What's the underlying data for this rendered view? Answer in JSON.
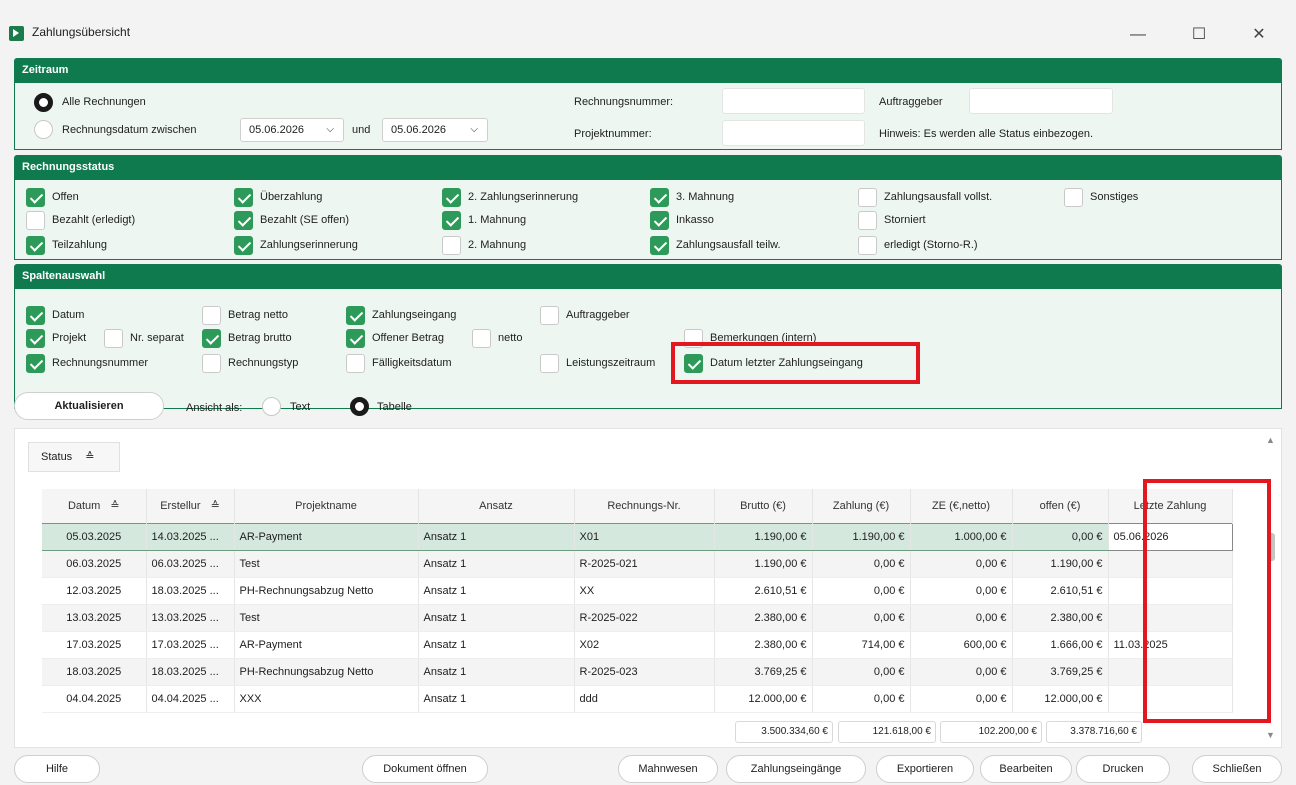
{
  "window": {
    "title": "Zahlungsübersicht",
    "min": "—",
    "max": "☐",
    "close": "✕"
  },
  "zeitraum": {
    "header": "Zeitraum",
    "alle": "Alle Rechnungen",
    "zwischen": "Rechnungsdatum zwischen",
    "date_from": "05.06.2026",
    "und": "und",
    "date_to": "05.06.2026",
    "rechnungsnummer_label": "Rechnungsnummer:",
    "projektnummer_label": "Projektnummer:",
    "auftraggeber_label": "Auftraggeber",
    "hinweis": "Hinweis: Es werden alle Status einbezogen."
  },
  "status": {
    "header": "Rechnungsstatus",
    "items": [
      {
        "label": "Offen",
        "checked": true
      },
      {
        "label": "Bezahlt (erledigt)",
        "checked": false
      },
      {
        "label": "Teilzahlung",
        "checked": true
      },
      {
        "label": "Überzahlung",
        "checked": true
      },
      {
        "label": "Bezahlt (SE offen)",
        "checked": true
      },
      {
        "label": "Zahlungserinnerung",
        "checked": true
      },
      {
        "label": "2. Zahlungserinnerung",
        "checked": true
      },
      {
        "label": "1. Mahnung",
        "checked": true
      },
      {
        "label": "2. Mahnung",
        "checked": false
      },
      {
        "label": "3. Mahnung",
        "checked": true
      },
      {
        "label": "Inkasso",
        "checked": true
      },
      {
        "label": "Zahlungsausfall teilw.",
        "checked": true
      },
      {
        "label": "Zahlungsausfall vollst.",
        "checked": false
      },
      {
        "label": "Storniert",
        "checked": false
      },
      {
        "label": "erledigt (Storno-R.)",
        "checked": false
      },
      {
        "label": "Sonstiges",
        "checked": false
      }
    ]
  },
  "spalten": {
    "header": "Spaltenauswahl",
    "items": [
      {
        "label": "Datum",
        "checked": true
      },
      {
        "label": "Projekt",
        "checked": true
      },
      {
        "label": "Nr. separat",
        "checked": false
      },
      {
        "label": "Rechnungsnummer",
        "checked": true
      },
      {
        "label": "Betrag netto",
        "checked": false
      },
      {
        "label": "Betrag brutto",
        "checked": true
      },
      {
        "label": "Rechnungstyp",
        "checked": false
      },
      {
        "label": "Zahlungseingang",
        "checked": true
      },
      {
        "label": "Offener Betrag",
        "checked": true
      },
      {
        "label": "netto",
        "checked": false
      },
      {
        "label": "Fälligkeitsdatum",
        "checked": false
      },
      {
        "label": "Auftraggeber",
        "checked": false
      },
      {
        "label": "Leistungszeitraum",
        "checked": false
      },
      {
        "label": "Bemerkungen (intern)",
        "checked": false
      },
      {
        "label": "Datum letzter Zahlungseingang",
        "checked": true
      }
    ]
  },
  "view": {
    "refresh": "Aktualisieren",
    "ansicht": "Ansicht als:",
    "text": "Text",
    "tabelle": "Tabelle",
    "group_chip": "Status",
    "sort_icon": "≙"
  },
  "table": {
    "columns": [
      "Datum",
      "Erstellur",
      "Projektname",
      "Ansatz",
      "Rechnungs-Nr.",
      "Brutto (€)",
      "Zahlung (€)",
      "ZE (€,netto)",
      "offen (€)",
      "Letzte Zahlung"
    ],
    "rows": [
      [
        "05.03.2025",
        "14.03.2025 ...",
        "AR-Payment",
        "Ansatz 1",
        "X01",
        "1.190,00 €",
        "1.190,00 €",
        "1.000,00 €",
        "0,00 €",
        "05.06.2026"
      ],
      [
        "06.03.2025",
        "06.03.2025 ...",
        "Test",
        "Ansatz 1",
        "R-2025-021",
        "1.190,00 €",
        "0,00 €",
        "0,00 €",
        "1.190,00 €",
        ""
      ],
      [
        "12.03.2025",
        "18.03.2025 ...",
        "PH-Rechnungsabzug Netto",
        "Ansatz 1",
        "XX",
        "2.610,51 €",
        "0,00 €",
        "0,00 €",
        "2.610,51 €",
        ""
      ],
      [
        "13.03.2025",
        "13.03.2025 ...",
        "Test",
        "Ansatz 1",
        "R-2025-022",
        "2.380,00 €",
        "0,00 €",
        "0,00 €",
        "2.380,00 €",
        ""
      ],
      [
        "17.03.2025",
        "17.03.2025 ...",
        "AR-Payment",
        "Ansatz 1",
        "X02",
        "2.380,00 €",
        "714,00 €",
        "600,00 €",
        "1.666,00 €",
        "11.03.2025"
      ],
      [
        "18.03.2025",
        "18.03.2025 ...",
        "PH-Rechnungsabzug Netto",
        "Ansatz 1",
        "R-2025-023",
        "3.769,25 €",
        "0,00 €",
        "0,00 €",
        "3.769,25 €",
        ""
      ],
      [
        "04.04.2025",
        "04.04.2025 ...",
        "XXX",
        "Ansatz 1",
        "ddd",
        "12.000,00 €",
        "0,00 €",
        "0,00 €",
        "12.000,00 €",
        ""
      ]
    ],
    "sums": [
      "3.500.334,60 €",
      "121.618,00 €",
      "102.200,00 €",
      "3.378.716,60 €"
    ]
  },
  "footer": {
    "hilfe": "Hilfe",
    "dokument": "Dokument öffnen",
    "mahnwesen": "Mahnwesen",
    "zahlungseingaenge": "Zahlungseingänge",
    "exportieren": "Exportieren",
    "bearbeiten": "Bearbeiten",
    "drucken": "Drucken",
    "schliessen": "Schließen"
  },
  "colors": {
    "accent": "#0f7a4e",
    "check": "#2e9a5a",
    "highlight": "#e3171f"
  }
}
